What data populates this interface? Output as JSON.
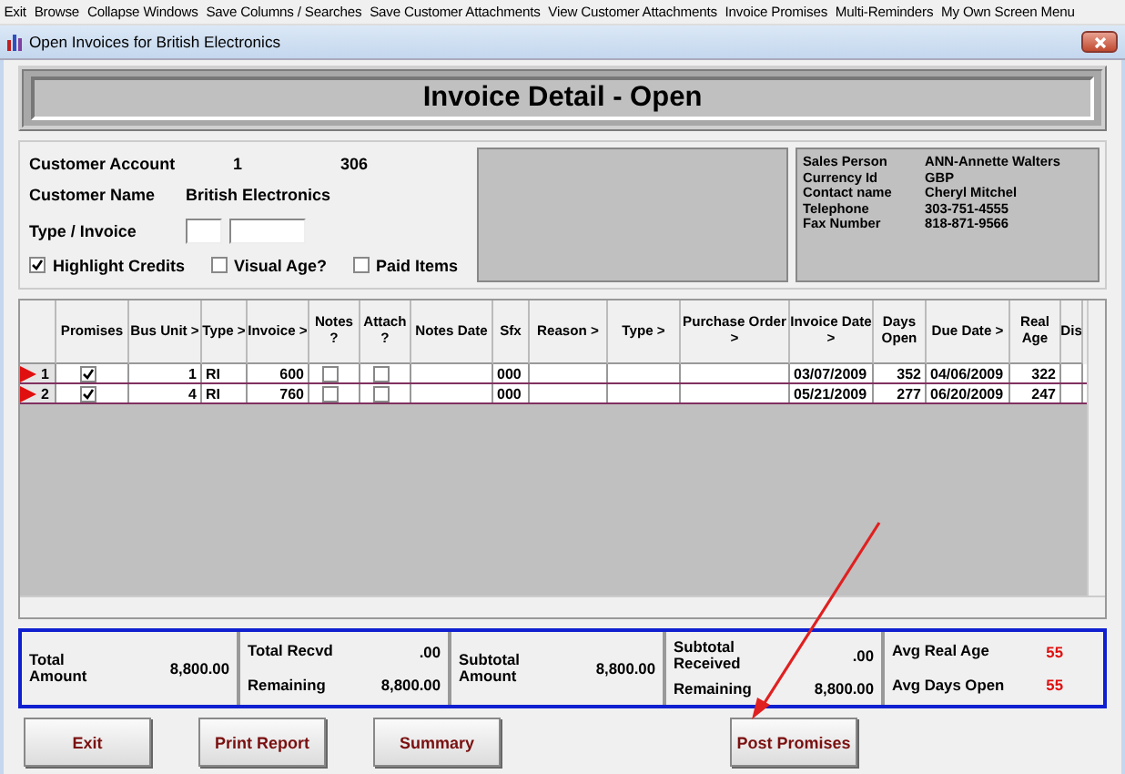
{
  "menu": [
    "Exit",
    "Browse",
    "Collapse Windows",
    "Save Columns / Searches",
    "Save Customer Attachments",
    "View Customer Attachments",
    "Invoice Promises",
    "Multi-Reminders",
    "My Own Screen Menu"
  ],
  "window": {
    "title": "Open Invoices for British Electronics"
  },
  "header": {
    "title": "Invoice Detail - Open"
  },
  "customer": {
    "account_label": "Customer Account",
    "account_values": [
      "1",
      "306"
    ],
    "name_label": "Customer Name",
    "name_value": "British Electronics",
    "type_invoice_label": "Type / Invoice",
    "options": [
      {
        "label": "Highlight Credits",
        "checked": true
      },
      {
        "label": "Visual Age?",
        "checked": false
      },
      {
        "label": "Paid Items",
        "checked": false
      }
    ]
  },
  "contact": [
    {
      "label": "Sales Person",
      "value": "ANN-Annette Walters"
    },
    {
      "label": "Currency Id",
      "value": "GBP"
    },
    {
      "label": "Contact name",
      "value": "Cheryl Mitchel"
    },
    {
      "label": "Telephone",
      "value": "303-751-4555"
    },
    {
      "label": "Fax Number",
      "value": "818-871-9566"
    }
  ],
  "table": {
    "columns": [
      "Promises",
      "Bus Unit >",
      "Type >",
      "Invoice >",
      "Notes ?",
      "Attach ?",
      "Notes Date",
      "Sfx",
      "Reason >",
      "Type >",
      "Purchase Order >",
      "Invoice Date >",
      "Days Open",
      "Due Date >",
      "Real Age",
      "Dis"
    ],
    "rows": [
      {
        "number": "1",
        "promise": true,
        "bus_unit": "1",
        "type": "RI",
        "invoice": "600",
        "notes": false,
        "attach": false,
        "sfx": "000",
        "invoice_date": "03/07/2009",
        "days_open": "352",
        "due_date": "04/06/2009",
        "real_age": "322"
      },
      {
        "number": "2",
        "promise": true,
        "bus_unit": "4",
        "type": "RI",
        "invoice": "760",
        "notes": false,
        "attach": false,
        "sfx": "000",
        "invoice_date": "05/21/2009",
        "days_open": "277",
        "due_date": "06/20/2009",
        "real_age": "247"
      }
    ]
  },
  "totals": [
    {
      "label": "Total Amount",
      "value": "8,800.00"
    },
    {
      "label": "Total Recvd",
      "value": ".00",
      "label_2": "Remaining",
      "value_2": "8,800.00"
    },
    {
      "label": "Subtotal Amount",
      "value": "8,800.00"
    },
    {
      "label": "Subtotal Received",
      "value": ".00",
      "label_2": "Remaining",
      "value_2": "8,800.00"
    },
    {
      "label": "Avg Real Age",
      "value": "55",
      "label_2": "Avg Days Open",
      "value_2": "55"
    }
  ],
  "buttons": [
    "Exit",
    "Print Report",
    "Summary",
    "Post Promises"
  ]
}
